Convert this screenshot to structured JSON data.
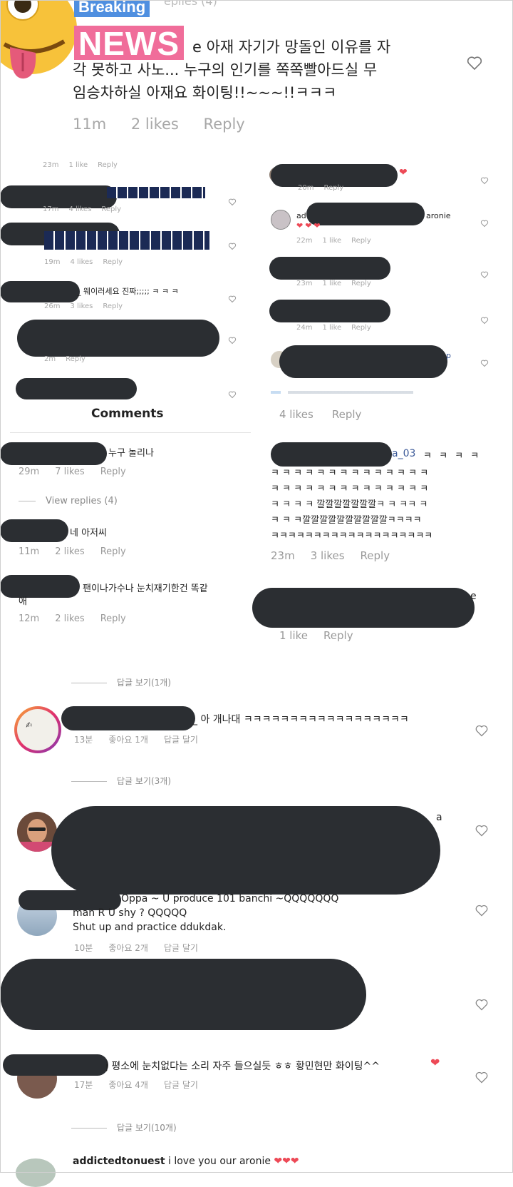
{
  "badge": {
    "breaking": "Breaking",
    "news": "NEWS"
  },
  "top_comment": {
    "line1_suffix": "e 아재 자기가 망돌인 이유를 자",
    "line2": "각 못하고 사노... 누구의 인기를 쪽쪽빨아드실 무",
    "line3": "임승차하실 아재요 화이팅!!~~~!!ㅋㅋㅋ",
    "time": "11m",
    "likes": "2 likes",
    "reply": "Reply"
  },
  "left_small": {
    "r1": {
      "time": "23m",
      "likes": "1 like",
      "reply": "Reply"
    },
    "r2": {
      "time": "17m",
      "likes": "4 likes",
      "reply": "Reply"
    },
    "r3": {
      "time": "19m",
      "likes": "4 likes",
      "reply": "Reply"
    },
    "r4_text": "_ 웨이러세요 진짜;;;;; ㅋ ㅋ ㅋ",
    "r4": {
      "time": "26m",
      "likes": "3 likes",
      "reply": "Reply"
    },
    "r5_time": "2m",
    "r5_reply": "Reply"
  },
  "right_small": {
    "r1": {
      "time": "20m",
      "reply": "Reply"
    },
    "r2_user": "ad",
    "r2_suffix": "aronie",
    "r2": {
      "time": "22m",
      "likes": "1 like",
      "reply": "Reply"
    },
    "r3": {
      "time": "23m",
      "likes": "1 like",
      "reply": "Reply"
    },
    "r4": {
      "time": "24m",
      "likes": "1 like",
      "reply": "Reply"
    },
    "r5_suffix": "p"
  },
  "comments_header": "Comments",
  "left_mid": {
    "c1_text": "누구 놀리나",
    "c1": {
      "time": "29m",
      "likes": "7 likes",
      "reply": "Reply"
    },
    "view_replies": "View replies (4)",
    "c2_text": "네 아저씨",
    "c2": {
      "time": "11m",
      "likes": "2 likes",
      "reply": "Reply"
    },
    "c3_text": "팬이나가수나 눈치재기한건 똑같",
    "c3_text2": "애",
    "c3": {
      "time": "12m",
      "likes": "2 likes",
      "reply": "Reply"
    }
  },
  "right_mid": {
    "top_likes": "4 likes",
    "top_reply": "Reply",
    "user_suffix": "a_03",
    "lines": [
      "ㅋ ㅋ ㅋ ㅋ",
      "ㅋ ㅋ ㅋ ㅋ ㅋ ㅋ ㅋ ㅋ ㅋ ㅋ ㅋ ㅋ ㅋ ㅋ",
      "ㅋ ㅋ ㅋ ㅋ ㅋ ㅋ ㅋ ㅋ ㅋ ㅋ ㅋ ㅋ ㅋ ㅋ",
      "ㅋ  ㅋ ㅋ ㅋ  깔깔깔깔깔깔깔ㅋ ㅋ  ㅋㅋ  ㅋ",
      "ㅋ ㅋ  ㅋ깔깔깔깔깔깔깔깔깔깔ㅋㅋㅋㅋ",
      "ㅋㅋㅋㅋㅋㅋㅋㅋㅋㅋㅋㅋㅋㅋㅋㅋㅋㅋㅋ"
    ],
    "meta": {
      "time": "23m",
      "likes": "3 likes",
      "reply": "Reply"
    },
    "c2_suffix": "e",
    "c2_likes": "1 like",
    "c2_reply": "Reply"
  },
  "korean": {
    "view_replies_1": "답글 보기(1개)",
    "c1_text": "_ 아 개나대 ㅋㅋㅋㅋㅋㅋㅋㅋㅋㅋㅋㅋㅋㅋㅋㅋㅋㅋ",
    "c1_meta": {
      "time": "13분",
      "likes": "좋아요 1개",
      "reply": "답글 달기"
    },
    "view_replies_3": "답글 보기(3개)",
    "c2_suffix": "a",
    "c3_line1": "Oppa ~ U produce 101 banchi ~QQQQQQQ",
    "c3_line2": "man R U shy ? QQQQQ",
    "c3_line3": "Shut up and practice ddukdak.",
    "c3_meta": {
      "time": "10분",
      "likes": "좋아요 2개",
      "reply": "답글 달기"
    },
    "c5_text": "j 평소에 눈치없다는 소리 자주 들으실듯 ㅎㅎ 황민현만 화이팅^^",
    "c5_meta": {
      "time": "17분",
      "likes": "좋아요 4개",
      "reply": "답글 달기"
    },
    "view_replies_10": "답글 보기(10개)",
    "c6_user": "addictedtonuest",
    "c6_text": " i love you our aronie "
  },
  "colors": {
    "redaction": "#2b2e32",
    "heart_red": "#ed4956",
    "link_blue": "#3b5998",
    "badge_blue": "#4f8fe0",
    "badge_pink": "#f06d9a"
  }
}
